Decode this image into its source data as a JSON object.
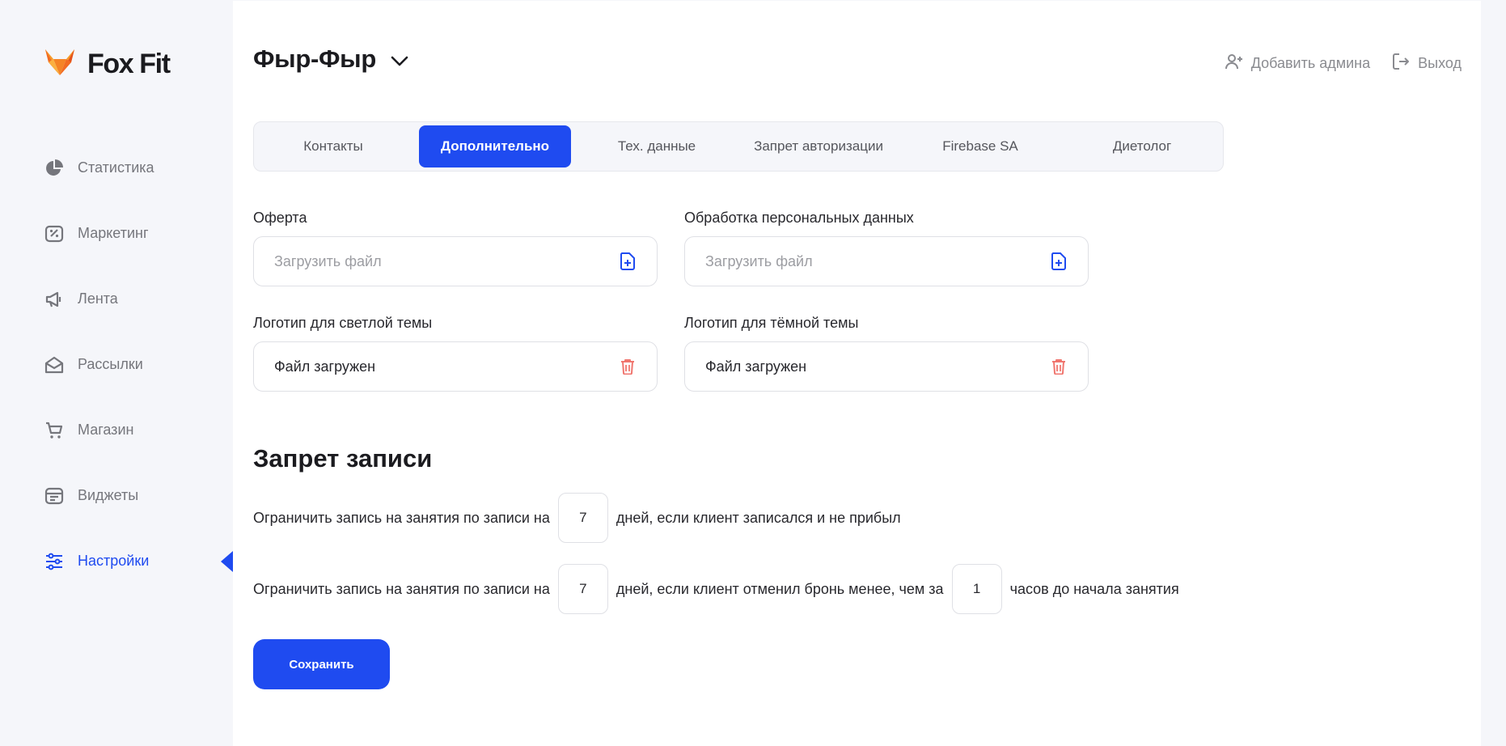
{
  "brand": {
    "name": "Fox Fit"
  },
  "sidebar": {
    "items": [
      {
        "label": "Статистика",
        "icon": "pie-chart-icon",
        "active": false
      },
      {
        "label": "Маркетинг",
        "icon": "discount-tag-icon",
        "active": false
      },
      {
        "label": "Лента",
        "icon": "megaphone-icon",
        "active": false
      },
      {
        "label": "Рассылки",
        "icon": "mail-open-icon",
        "active": false
      },
      {
        "label": "Магазин",
        "icon": "cart-icon",
        "active": false
      },
      {
        "label": "Виджеты",
        "icon": "widgets-icon",
        "active": false
      },
      {
        "label": "Настройки",
        "icon": "sliders-icon",
        "active": true
      }
    ]
  },
  "header": {
    "title": "Фыр-Фыр",
    "add_admin": "Добавить админа",
    "logout": "Выход"
  },
  "tabs": [
    {
      "label": "Контакты",
      "active": false
    },
    {
      "label": "Дополнительно",
      "active": true
    },
    {
      "label": "Тех. данные",
      "active": false
    },
    {
      "label": "Запрет авторизации",
      "active": false
    },
    {
      "label": "Firebase SA",
      "active": false
    },
    {
      "label": "Диетолог",
      "active": false
    }
  ],
  "files": {
    "offer": {
      "label": "Оферта",
      "placeholder": "Загрузить файл"
    },
    "personal_data": {
      "label": "Обработка персональных данных",
      "placeholder": "Загрузить файл"
    },
    "logo_light": {
      "label": "Логотип для светлой темы",
      "value": "Файл загружен"
    },
    "logo_dark": {
      "label": "Логотип для тёмной темы",
      "value": "Файл загружен"
    }
  },
  "restriction": {
    "title": "Запрет записи",
    "rule1": {
      "prefix": "Ограничить запись на занятия по записи на",
      "days": "7",
      "suffix": "дней, если клиент записался и не прибыл"
    },
    "rule2": {
      "prefix": "Ограничить запись на занятия по записи на",
      "days": "7",
      "middle": "дней, если клиент отменил бронь менее, чем за",
      "hours": "1",
      "suffix": "часов до начала занятия"
    }
  },
  "save_label": "Сохранить",
  "colors": {
    "accent": "#1f4bf0",
    "sidebar_bg": "#f5f6fa",
    "delete": "#f0766f",
    "brand_orange": "#f26b21"
  }
}
